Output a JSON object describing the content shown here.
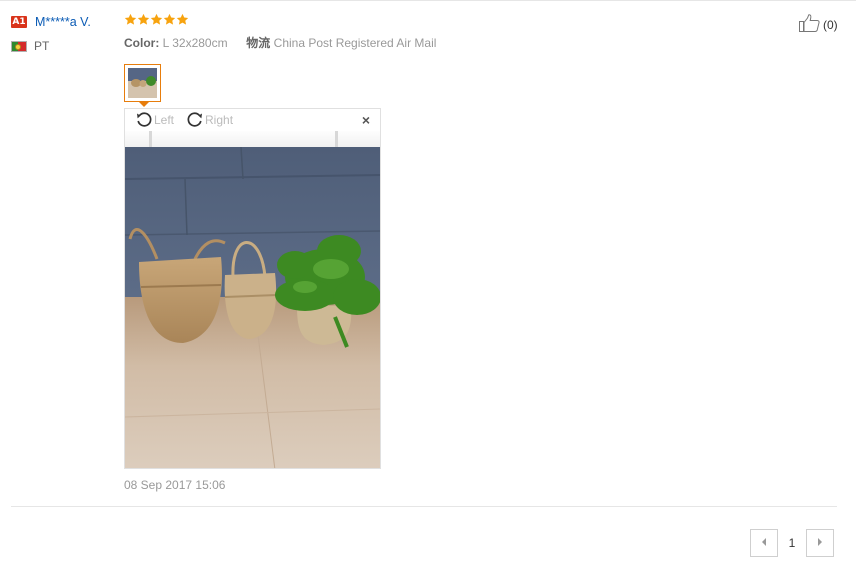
{
  "review": {
    "level_badge": "A1",
    "user_name": "M*****a V.",
    "country": "PT",
    "rating": 5,
    "color_label": "Color:",
    "color_value": "L 32x280cm",
    "shipping_label": "物流",
    "shipping_value": "China Post Registered Air Mail",
    "helpful_count": "(0)",
    "date": "08 Sep 2017 15:06",
    "image_viewer": {
      "rotate_left_label": "Left",
      "rotate_right_label": "Right",
      "close_glyph": "×"
    }
  },
  "pagination": {
    "current_page": "1"
  },
  "colors": {
    "star": "#f7a30f",
    "thumb_border": "#e77d0c",
    "user_name": "#0a5bb5",
    "badge": "#d9331a"
  },
  "icons": [
    "star-icon",
    "thumbs-up-icon",
    "rotate-left-icon",
    "rotate-right-icon",
    "close-icon",
    "chevron-left-icon",
    "chevron-right-icon",
    "portugal-flag-icon"
  ]
}
